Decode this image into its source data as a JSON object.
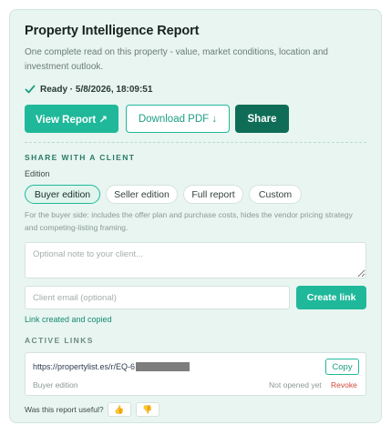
{
  "report": {
    "title": "Property Intelligence Report",
    "subtitle": "One complete read on this property - value, market conditions, location and investment outlook.",
    "status": "Ready · 5/8/2026, 18:09:51"
  },
  "actions": {
    "view_label": "View Report ↗",
    "pdf_label": "Download PDF ↓",
    "share_label": "Share"
  },
  "share": {
    "section_label": "SHARE WITH A CLIENT",
    "edition_label": "Edition",
    "editions": [
      "Buyer edition",
      "Seller edition",
      "Full report",
      "Custom"
    ],
    "selected_edition": "Buyer edition",
    "hint": "For the buyer side: includes the offer plan and purchase costs, hides the vendor pricing strategy and competing-listing framing.",
    "note_placeholder": "Optional note to your client...",
    "email_placeholder": "Client email (optional)",
    "create_label": "Create link",
    "created_message": "Link created and copied"
  },
  "active_links": {
    "section_label": "ACTIVE LINKS",
    "items": [
      {
        "url": "https://propertylist.es/r/EQ-6",
        "edition": "Buyer edition",
        "status": "Not opened yet",
        "copy_label": "Copy",
        "revoke_label": "Revoke"
      }
    ]
  },
  "feedback": {
    "question": "Was this report useful?",
    "up": "👍",
    "down": "👎"
  },
  "colors": {
    "accent": "#1fb89a",
    "dark_accent": "#0f6d57",
    "panel_bg": "#e8f5f0",
    "danger": "#d24a3c"
  }
}
